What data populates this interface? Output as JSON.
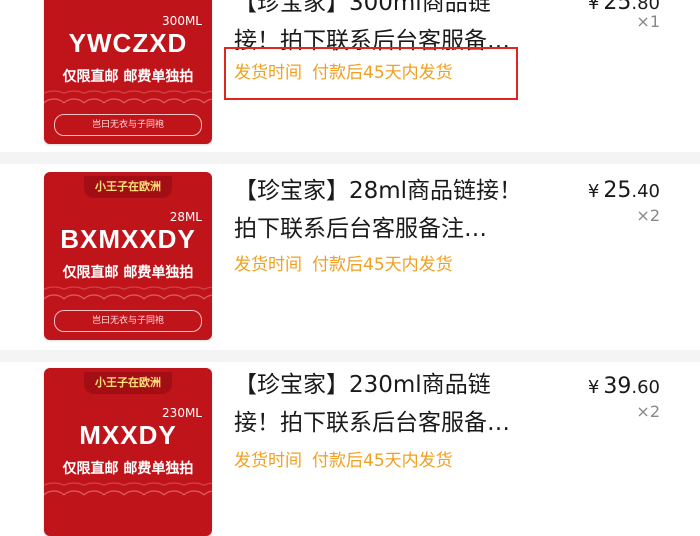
{
  "colors": {
    "accent": "#f0a020",
    "thumb": "#c0141b",
    "highlight": "#e0271f"
  },
  "items": [
    {
      "thumb": {
        "badge": "",
        "volume": "300ML",
        "brand": "YWCZXD",
        "tag": "仅限直邮 邮费单独拍",
        "footer": "岂曰无衣与子同袍"
      },
      "title": "【珍宝家】300ml商品链\n接！拍下联系后台客服备…",
      "ship_label": "发货时间",
      "ship_value": "付款后45天内发货",
      "price_symbol": "¥",
      "price_int": "25",
      "price_dec": ".80",
      "qty": "×1"
    },
    {
      "thumb": {
        "badge": "小王子在欧洲",
        "volume": "28ML",
        "brand": "BXMXXDY",
        "tag": "仅限直邮 邮费单独拍",
        "footer": "岂曰无衣与子同袍"
      },
      "title": "【珍宝家】28ml商品链接！\n拍下联系后台客服备注…",
      "ship_label": "发货时间",
      "ship_value": "付款后45天内发货",
      "price_symbol": "¥",
      "price_int": "25",
      "price_dec": ".40",
      "qty": "×2"
    },
    {
      "thumb": {
        "badge": "小王子在欧洲",
        "volume": "230ML",
        "brand": "MXXDY",
        "tag": "仅限直邮 邮费单独拍",
        "footer": ""
      },
      "title": "【珍宝家】230ml商品链\n接！拍下联系后台客服备…",
      "ship_label": "发货时间",
      "ship_value": "付款后45天内发货",
      "price_symbol": "¥",
      "price_int": "39",
      "price_dec": ".60",
      "qty": "×2"
    }
  ]
}
